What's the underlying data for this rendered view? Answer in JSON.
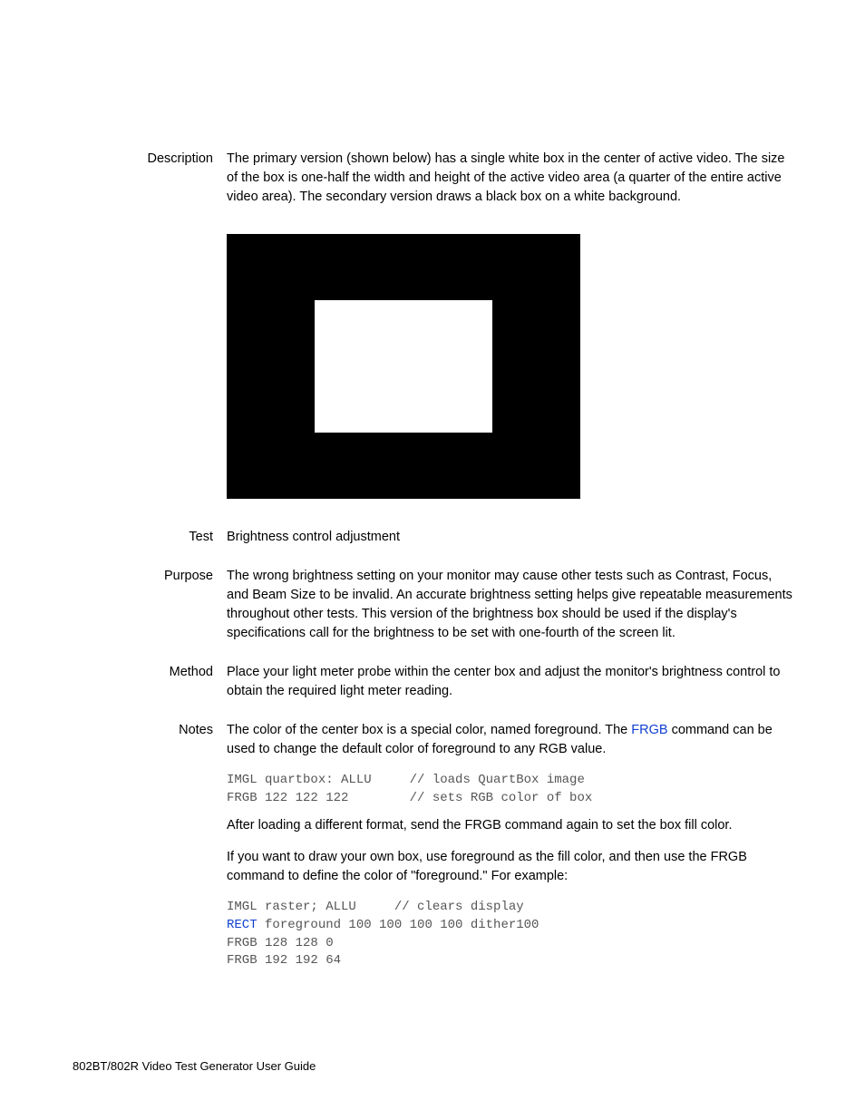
{
  "sections": {
    "description": {
      "label": "Description",
      "text": "The primary version (shown below) has a single white box in the center of active video. The size of the box is one-half the width and height of the active video area (a quarter of the entire active video area). The secondary version draws a black box on a white background."
    },
    "test": {
      "label": "Test",
      "text": "Brightness control adjustment"
    },
    "purpose": {
      "label": "Purpose",
      "text": "The wrong brightness setting on your monitor may cause other tests such as Contrast, Focus, and Beam Size to be invalid. An accurate brightness setting helps give repeatable measurements throughout other tests. This version of the brightness box should be used if the display's specifications call for the brightness to be set with one-fourth of the screen lit."
    },
    "method": {
      "label": "Method",
      "text": "Place your light meter probe within the center box and adjust the monitor's brightness control to obtain the required light meter reading."
    },
    "notes": {
      "label": "Notes",
      "p1_before": "The color of the center box is a special color, named foreground. The ",
      "p1_link": "FRGB",
      "p1_after": " command can be used to change the default color of foreground to any RGB value.",
      "code1": "IMGL quartbox: ALLU     // loads QuartBox image\nFRGB 122 122 122        // sets RGB color of box",
      "p2": "After loading a different format, send the FRGB command again to set the box fill color.",
      "p3": "If you want to draw your own box, use foreground as the fill color, and then use the FRGB command to define the color of \"foreground.\" For example:",
      "code2_l1": "IMGL raster; ALLU     // clears display",
      "code2_l2_link": "RECT",
      "code2_l2_rest": " foreground 100 100 100 100 dither100",
      "code2_l3": "FRGB 128 128 0",
      "code2_l4": "FRGB 192 192 64"
    }
  },
  "footer": "802BT/802R Video Test Generator User Guide"
}
